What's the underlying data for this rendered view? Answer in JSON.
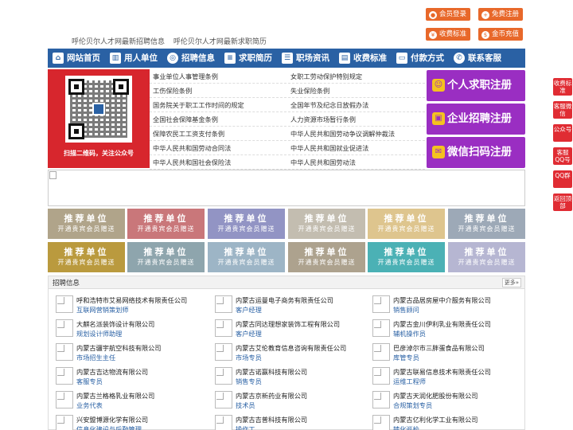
{
  "header": {
    "links": [
      "呼伦贝尔人才网最新招聘信息",
      "呼伦贝尔人才网最新求职简历"
    ],
    "buttons": [
      {
        "label": "会员登录",
        "icon": "user-icon"
      },
      {
        "label": "免费注册",
        "icon": "user-add-icon"
      },
      {
        "label": "收费标准",
        "icon": "coin-icon"
      },
      {
        "label": "金币充值",
        "icon": "wallet-icon"
      }
    ],
    "accent": "#e8682a"
  },
  "nav": {
    "color": "#2a61a4",
    "items": [
      {
        "label": "网站首页",
        "icon": "home-icon"
      },
      {
        "label": "用人单位",
        "icon": "building-icon"
      },
      {
        "label": "招聘信息",
        "icon": "target-icon"
      },
      {
        "label": "求职简历",
        "icon": "document-icon"
      },
      {
        "label": "职场资讯",
        "icon": "news-icon"
      },
      {
        "label": "收费标准",
        "icon": "chart-icon"
      },
      {
        "label": "付款方式",
        "icon": "card-icon"
      },
      {
        "label": "联系客服",
        "icon": "phone-icon"
      }
    ]
  },
  "qr": {
    "caption": "扫描二维码，关注公众号"
  },
  "laws": [
    [
      "事业单位人事管理条例",
      "女职工劳动保护特别规定"
    ],
    [
      "工伤保险条例",
      "失业保险条例"
    ],
    [
      "国务院关于职工工作时间的规定",
      "全国年节及纪念日放假办法"
    ],
    [
      "全国社会保障基金条例",
      "人力资源市场暂行条例"
    ],
    [
      "保障农民工工资支付条例",
      "中华人民共和国劳动争议调解仲裁法"
    ],
    [
      "中华人民共和国劳动合同法",
      "中华人民共和国就业促进法"
    ],
    [
      "中华人民共和国社会保险法",
      "中华人民共和国劳动法"
    ]
  ],
  "register": [
    {
      "label": "个人求职注册",
      "icon": "person-icon"
    },
    {
      "label": "企业招聘注册",
      "icon": "company-icon"
    },
    {
      "label": "微信扫码注册",
      "icon": "wechat-icon"
    }
  ],
  "side": [
    "收费标准",
    "客服微信",
    "公众号",
    "客服QQ号",
    "QQ群",
    "返回顶部"
  ],
  "tiles": {
    "title": "推荐单位",
    "subtitle": "开通贵宾会员赠送",
    "colors": [
      "#b0a48a",
      "#c9777a",
      "#9294c4",
      "#c3bdb0",
      "#dec58e",
      "#9da9b7",
      "#ba9a3e",
      "#8ea5ad",
      "#9db5c6",
      "#ada28e",
      "#4bb1b5",
      "#b6b6d2"
    ]
  },
  "jobs": {
    "title": "招聘信息",
    "more": "更多»",
    "items": [
      {
        "company": "呼和浩特市艾易网络技术有限责任公司",
        "position": "互联网营销策划师"
      },
      {
        "company": "内蒙古运曼电子商务有限责任公司",
        "position": "客户经理"
      },
      {
        "company": "内蒙古品居房屋中介服务有限公司",
        "position": "销售顾问"
      },
      {
        "company": "大麒名派装饰设计有限公司",
        "position": "规划设计师助理"
      },
      {
        "company": "内蒙古同达理想家装饰工程有限公司",
        "position": "客户经理"
      },
      {
        "company": "内蒙古金川伊利乳业有限责任公司",
        "position": "辅机操作员"
      },
      {
        "company": "内蒙古疆宇航空科技有限公司",
        "position": "市场招生主任"
      },
      {
        "company": "内蒙古艾伦教育信息咨询有限责任公司",
        "position": "市场专员"
      },
      {
        "company": "巴彦淖尔市三胖蛋食品有限公司",
        "position": "库管专员"
      },
      {
        "company": "内蒙古吉达物流有限公司",
        "position": "客服专员"
      },
      {
        "company": "内蒙古诺赢科技有限公司",
        "position": "销售专员"
      },
      {
        "company": "内蒙古联易信息技术有限责任公司",
        "position": "运维工程师"
      },
      {
        "company": "内蒙古兰格格乳业有限公司",
        "position": "业务代表"
      },
      {
        "company": "内蒙古京新药业有限公司",
        "position": "技术员"
      },
      {
        "company": "内蒙古天润化肥股份有限公司",
        "position": "合规策划专员"
      },
      {
        "company": "兴安盟博源化学有限公司",
        "position": "信息化建设与后勤管理"
      },
      {
        "company": "内蒙古吉普科技有限公司",
        "position": "操作工"
      },
      {
        "company": "内蒙古亿利化学工业有限公司",
        "position": "转化巡检"
      }
    ]
  }
}
